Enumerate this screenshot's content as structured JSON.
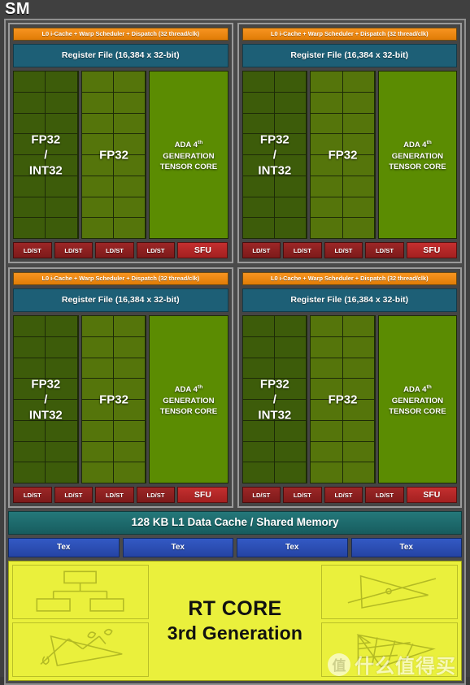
{
  "diagram": {
    "title": "SM",
    "partitions": [
      {
        "scheduler": "L0 i-Cache + Warp Scheduler + Dispatch (32 thread/clk)",
        "register_file": "Register File (16,384 x 32-bit)",
        "fp_int_label_line1": "FP32",
        "fp_int_label_line2": "/",
        "fp_int_label_line3": "INT32",
        "fp32_label": "FP32",
        "tensor_line1_prefix": "ADA 4",
        "tensor_line1_sup": "th",
        "tensor_line2": "GENERATION",
        "tensor_line3": "TENSOR CORE",
        "ldst_labels": [
          "LD/ST",
          "LD/ST",
          "LD/ST",
          "LD/ST"
        ],
        "sfu_label": "SFU"
      },
      {
        "scheduler": "L0 i-Cache + Warp Scheduler + Dispatch (32 thread/clk)",
        "register_file": "Register File (16,384 x 32-bit)",
        "fp_int_label_line1": "FP32",
        "fp_int_label_line2": "/",
        "fp_int_label_line3": "INT32",
        "fp32_label": "FP32",
        "tensor_line1_prefix": "ADA 4",
        "tensor_line1_sup": "th",
        "tensor_line2": "GENERATION",
        "tensor_line3": "TENSOR CORE",
        "ldst_labels": [
          "LD/ST",
          "LD/ST",
          "LD/ST",
          "LD/ST"
        ],
        "sfu_label": "SFU"
      },
      {
        "scheduler": "L0 i-Cache + Warp Scheduler + Dispatch (32 thread/clk)",
        "register_file": "Register File (16,384 x 32-bit)",
        "fp_int_label_line1": "FP32",
        "fp_int_label_line2": "/",
        "fp_int_label_line3": "INT32",
        "fp32_label": "FP32",
        "tensor_line1_prefix": "ADA 4",
        "tensor_line1_sup": "th",
        "tensor_line2": "GENERATION",
        "tensor_line3": "TENSOR CORE",
        "ldst_labels": [
          "LD/ST",
          "LD/ST",
          "LD/ST",
          "LD/ST"
        ],
        "sfu_label": "SFU"
      },
      {
        "scheduler": "L0 i-Cache + Warp Scheduler + Dispatch (32 thread/clk)",
        "register_file": "Register File (16,384 x 32-bit)",
        "fp_int_label_line1": "FP32",
        "fp_int_label_line2": "/",
        "fp_int_label_line3": "INT32",
        "fp32_label": "FP32",
        "tensor_line1_prefix": "ADA 4",
        "tensor_line1_sup": "th",
        "tensor_line2": "GENERATION",
        "tensor_line3": "TENSOR CORE",
        "ldst_labels": [
          "LD/ST",
          "LD/ST",
          "LD/ST",
          "LD/ST"
        ],
        "sfu_label": "SFU"
      }
    ],
    "l1_cache": "128 KB L1 Data Cache / Shared Memory",
    "tex_units": [
      "Tex",
      "Tex",
      "Tex",
      "Tex"
    ],
    "rt_core": {
      "title": "RT CORE",
      "subtitle": "3rd Generation",
      "icons": [
        "bvh-tree-icon",
        "ray-triangle-intersection-icon",
        "ray-scene-traversal-icon",
        "bvh-mesh-icon"
      ]
    },
    "watermark": {
      "badge": "值",
      "text": "什么值得买"
    },
    "colors": {
      "background": "#404040",
      "scheduler_orange": "#f08a0c",
      "register_file_teal": "#1d5f76",
      "fp_int_green": "#3d5c0a",
      "fp32_green": "#55750b",
      "tensor_green": "#5b8c02",
      "ldst_red": "#8c1f1f",
      "sfu_red": "#b32727",
      "l1_teal": "#1d6b6b",
      "tex_blue": "#2b4fb5",
      "rt_yellow": "#eaf03c"
    }
  }
}
